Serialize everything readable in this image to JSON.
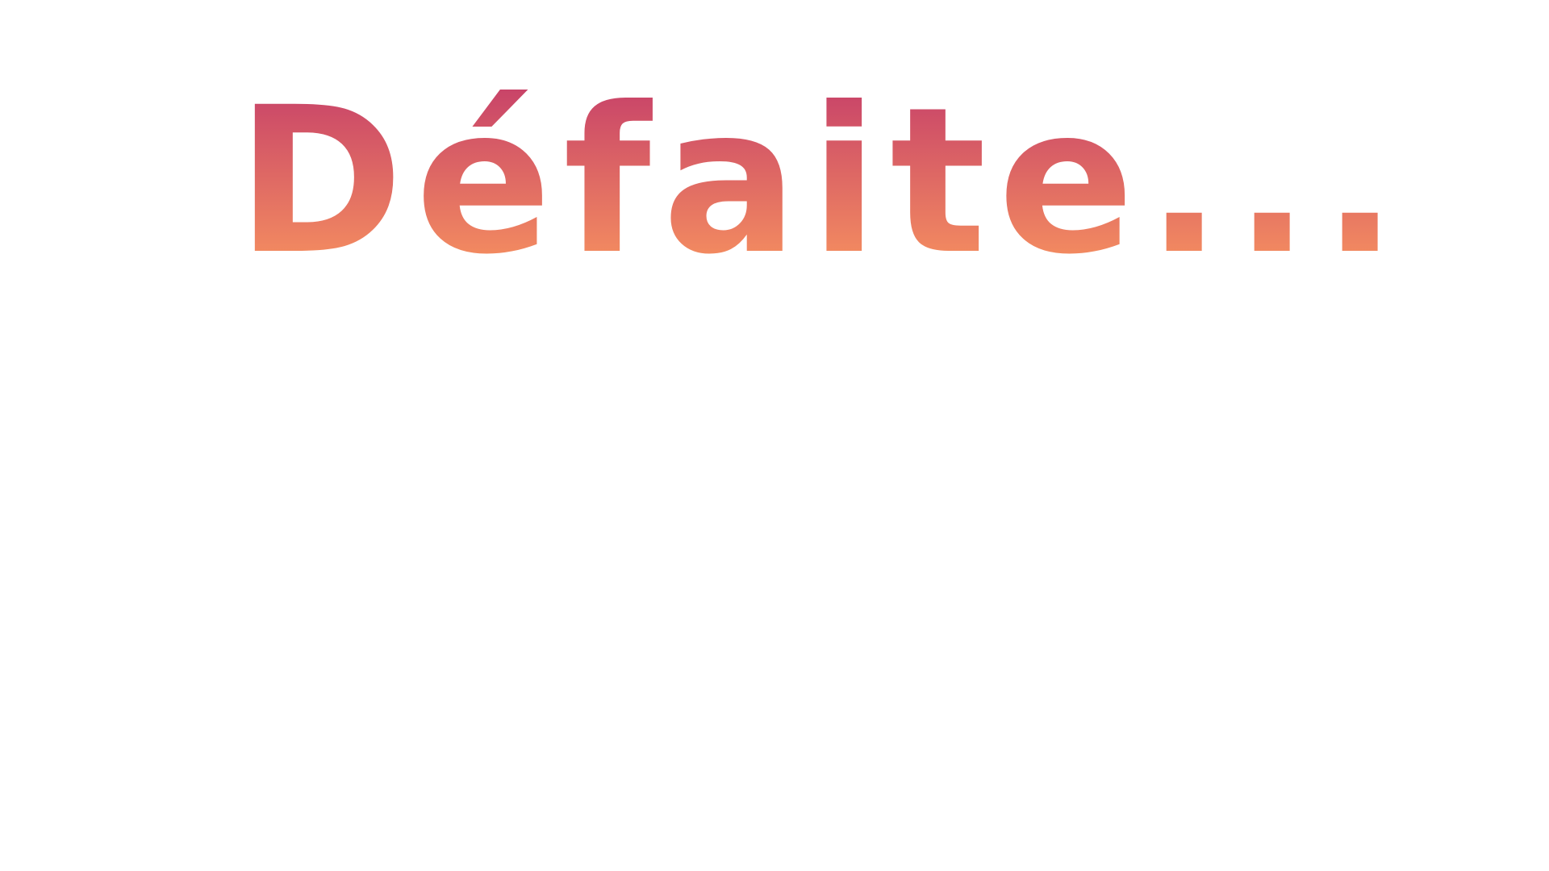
{
  "screen": {
    "title": "Défaite...",
    "background_color": "#ffffff",
    "title_gradient": {
      "start_color": "#c2396a",
      "end_color": "#fd9c5e"
    }
  }
}
